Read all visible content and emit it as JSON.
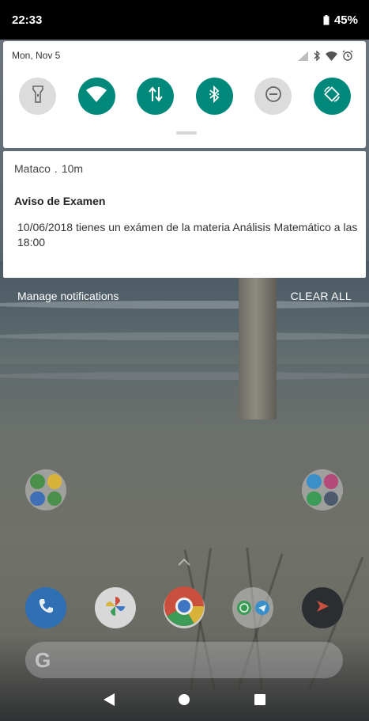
{
  "status_bar": {
    "time": "22:33",
    "battery": "45%"
  },
  "quick_settings": {
    "date": "Mon, Nov 5",
    "tiles": [
      {
        "name": "flashlight",
        "state": "off"
      },
      {
        "name": "wifi",
        "state": "on"
      },
      {
        "name": "mobile-data",
        "state": "on"
      },
      {
        "name": "bluetooth",
        "state": "on"
      },
      {
        "name": "do-not-disturb",
        "state": "off"
      },
      {
        "name": "auto-rotate",
        "state": "on"
      }
    ]
  },
  "notification": {
    "app": "Mataco",
    "separator": ".",
    "age": "10m",
    "title": "Aviso de Examen",
    "body": "10/06/2018 tienes un exámen de la materia Análisis Matemático a las 18:00"
  },
  "actions": {
    "manage": "Manage notifications",
    "clear_all": "CLEAR ALL"
  },
  "colors": {
    "accent": "#00897b",
    "tile_off": "#dcdcdc"
  }
}
